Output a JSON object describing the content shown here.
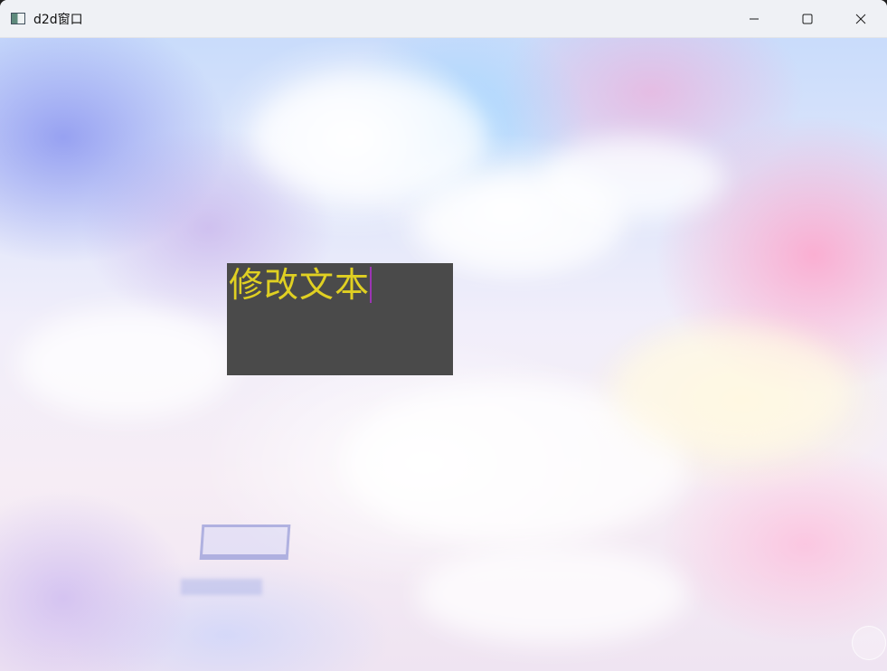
{
  "window": {
    "title": "d2d窗口",
    "icon": "app-window-icon",
    "controls": {
      "minimize_icon": "minimize-icon",
      "maximize_icon": "maximize-icon",
      "close_icon": "close-icon"
    }
  },
  "canvas": {
    "background": "pastel-sky-clouds-wallpaper",
    "edit_box": {
      "text": "修改文本",
      "background_color": "#4a4a4a",
      "text_color": "#e0d022",
      "caret_color": "#9c35b4"
    }
  }
}
